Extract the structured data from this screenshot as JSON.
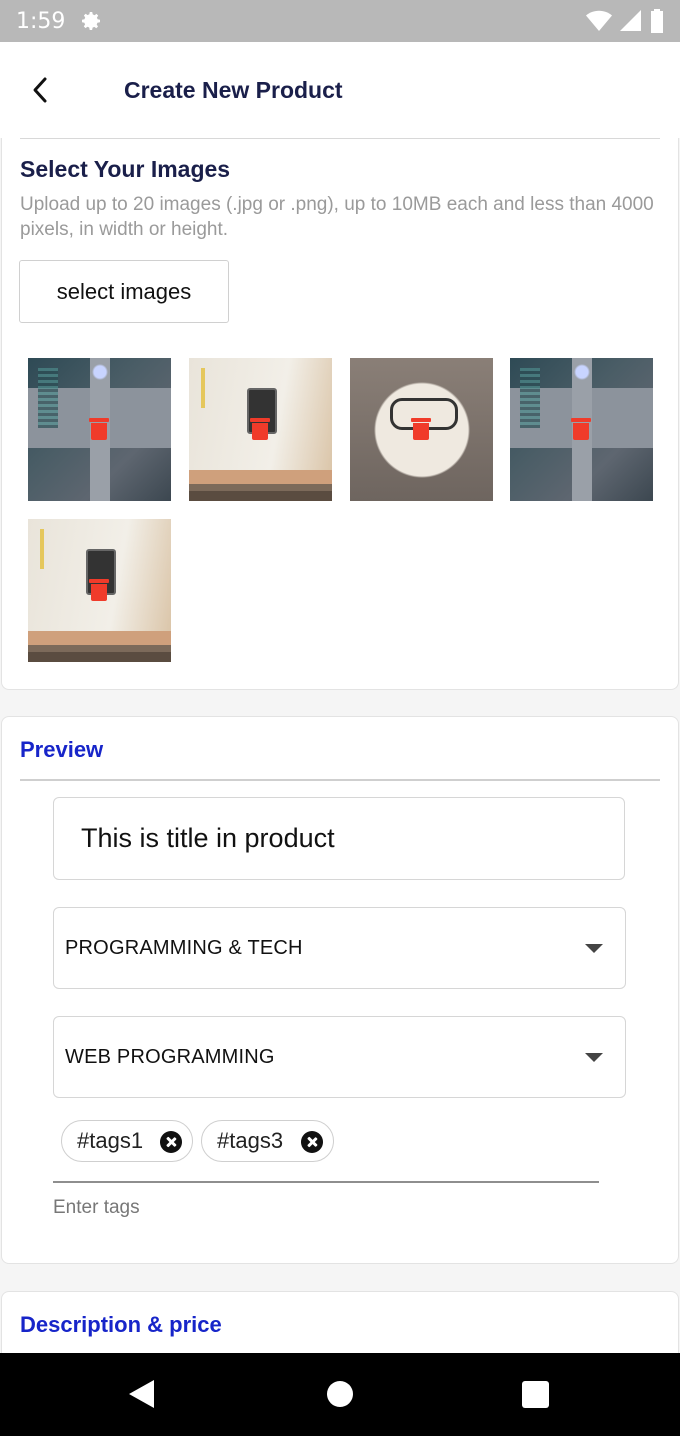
{
  "status_bar": {
    "time": "1:59",
    "icons": [
      "gear-icon",
      "wifi-icon",
      "signal-icon",
      "battery-icon"
    ]
  },
  "app_bar": {
    "back_icon": "chevron-left-icon",
    "title": "Create New Product"
  },
  "images_section": {
    "title": "Select Your Images",
    "subtitle": "Upload up to 20 images (.jpg or .png), up to 10MB each and less than 4000 pixels, in width or height.",
    "select_button": "select images",
    "thumbnails": [
      {
        "subject": "robot",
        "delete_icon": "trash-icon"
      },
      {
        "subject": "phone-on-desk",
        "delete_icon": "trash-icon"
      },
      {
        "subject": "glasses-on-book",
        "delete_icon": "trash-icon"
      },
      {
        "subject": "robot",
        "delete_icon": "trash-icon"
      },
      {
        "subject": "phone-on-desk",
        "delete_icon": "trash-icon"
      }
    ]
  },
  "preview_section": {
    "title": "Preview",
    "title_field": {
      "value": "This is title in product"
    },
    "category_select": {
      "value": "PROGRAMMING & TECH"
    },
    "subcategory_select": {
      "value": "WEB PROGRAMMING"
    },
    "tags": [
      {
        "label": "#tags1"
      },
      {
        "label": "#tags3"
      }
    ],
    "tags_input": {
      "placeholder": "Enter tags",
      "value": ""
    }
  },
  "description_section": {
    "title": "Description & price"
  },
  "nav_bar": {
    "icons": [
      "back-triangle-icon",
      "home-circle-icon",
      "recents-square-icon"
    ]
  },
  "colors": {
    "accent_blue": "#1725c9",
    "heading_navy": "#1a1f4a",
    "delete_red": "#f03b2a"
  }
}
